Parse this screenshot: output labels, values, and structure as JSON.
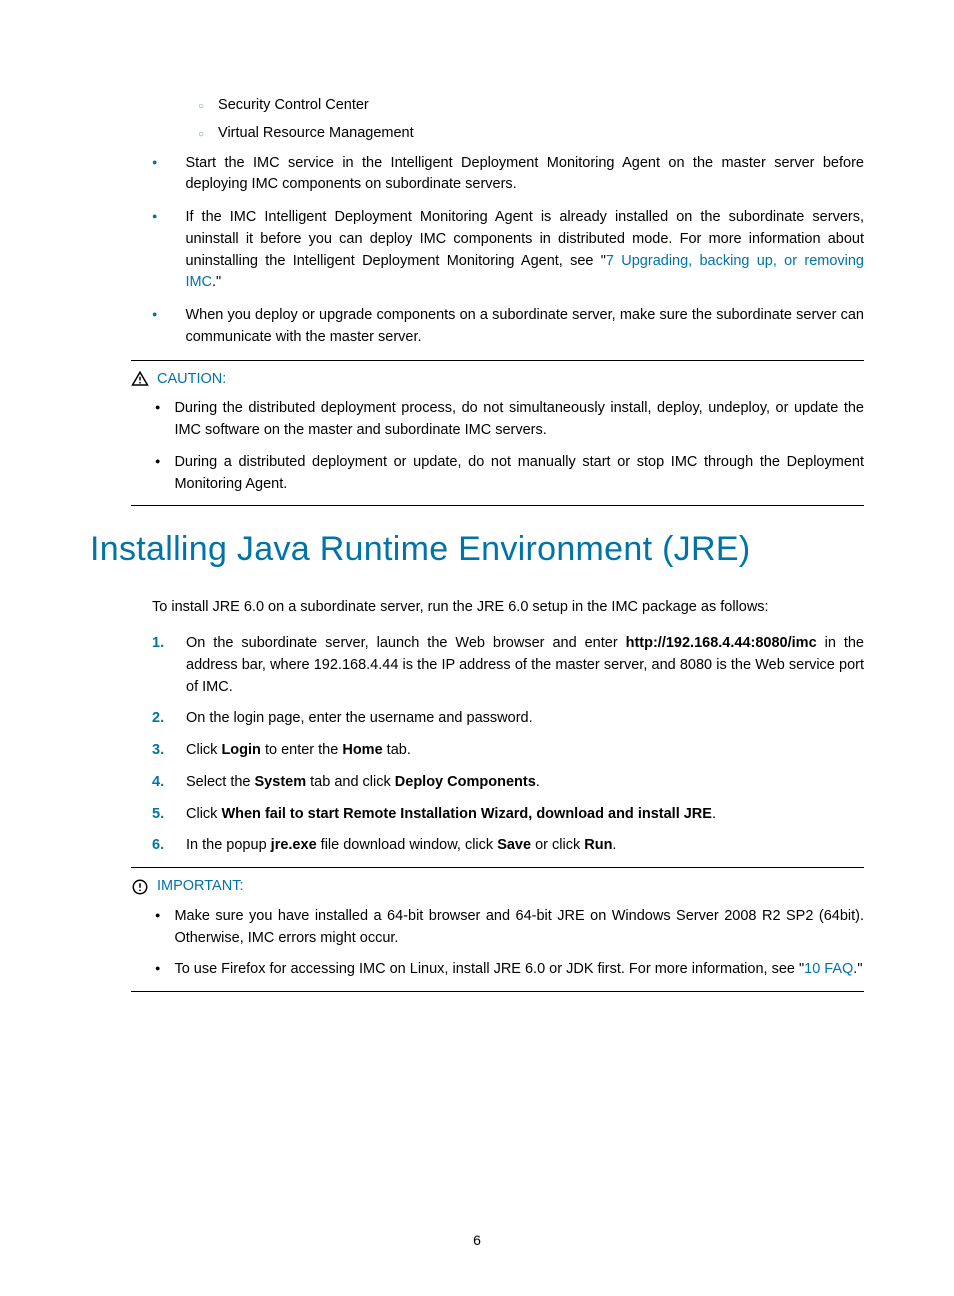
{
  "sublist": [
    "Security Control Center",
    "Virtual Resource Management"
  ],
  "mainlist": [
    {
      "text": "Start the IMC service in the Intelligent Deployment Monitoring Agent on the master server before deploying IMC components on subordinate servers."
    },
    {
      "parts": [
        {
          "t": "If the IMC Intelligent Deployment Monitoring Agent is already installed on the subordinate servers, uninstall it before you can deploy IMC components in distributed mode. For more information about uninstalling the Intelligent Deployment Monitoring Agent, see \""
        },
        {
          "link": "7 Upgrading, backing up, or removing IMC"
        },
        {
          "t": ".\""
        }
      ]
    },
    {
      "text": "When you deploy or upgrade components on a subordinate server, make sure the subordinate server can communicate with the master server."
    }
  ],
  "caution": {
    "title": "CAUTION:",
    "items": [
      "During the distributed deployment process, do not simultaneously install, deploy, undeploy, or update the IMC software on the master and subordinate IMC servers.",
      "During a distributed deployment or update, do not manually start or stop IMC through the Deployment Monitoring Agent."
    ]
  },
  "heading": "Installing Java Runtime Environment (JRE)",
  "intro": "To install JRE 6.0 on a subordinate server, run the JRE 6.0 setup in the IMC package as follows:",
  "steps": [
    {
      "num": "1.",
      "parts": [
        {
          "t": "On the subordinate server, launch the Web browser and enter "
        },
        {
          "b": "http://192.168.4.44:8080/imc"
        },
        {
          "t": " in the address bar, where 192.168.4.44 is the IP address of the master server, and 8080 is the Web service port of IMC."
        }
      ]
    },
    {
      "num": "2.",
      "parts": [
        {
          "t": "On the login page, enter the username and password."
        }
      ]
    },
    {
      "num": "3.",
      "parts": [
        {
          "t": "Click "
        },
        {
          "b": "Login"
        },
        {
          "t": " to enter the "
        },
        {
          "b": "Home"
        },
        {
          "t": " tab."
        }
      ]
    },
    {
      "num": "4.",
      "parts": [
        {
          "t": "Select the "
        },
        {
          "b": "System"
        },
        {
          "t": " tab and click "
        },
        {
          "b": "Deploy Components"
        },
        {
          "t": "."
        }
      ]
    },
    {
      "num": "5.",
      "parts": [
        {
          "t": "Click "
        },
        {
          "b": "When fail to start Remote Installation Wizard, download and install JRE"
        },
        {
          "t": "."
        }
      ]
    },
    {
      "num": "6.",
      "parts": [
        {
          "t": "In the popup "
        },
        {
          "b": "jre.exe"
        },
        {
          "t": " file download window, click "
        },
        {
          "b": "Save"
        },
        {
          "t": " or click "
        },
        {
          "b": "Run"
        },
        {
          "t": "."
        }
      ]
    }
  ],
  "important": {
    "title": "IMPORTANT:",
    "items": [
      {
        "parts": [
          {
            "t": "Make sure you have installed a 64-bit browser and 64-bit JRE on Windows Server 2008 R2 SP2 (64bit). Otherwise, IMC errors might occur."
          }
        ]
      },
      {
        "parts": [
          {
            "t": "To use Firefox for accessing IMC on Linux, install JRE 6.0 or JDK first. For more information, see \""
          },
          {
            "link": "10 FAQ"
          },
          {
            "t": ".\""
          }
        ]
      }
    ]
  },
  "pagenum": "6"
}
